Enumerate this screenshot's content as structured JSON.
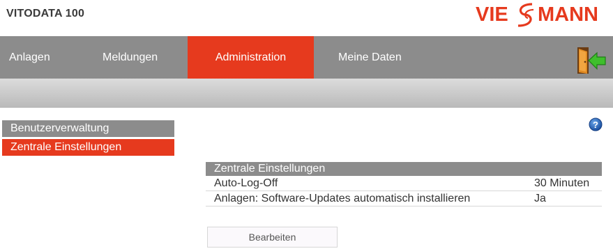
{
  "header": {
    "app_title": "VITODATA 100",
    "logo_text": "VIESSMANN",
    "brand_color": "#e63a1e"
  },
  "nav": {
    "items": [
      {
        "label": "Anlagen",
        "active": false
      },
      {
        "label": "Meldungen",
        "active": false
      },
      {
        "label": "Administration",
        "active": true
      },
      {
        "label": "Meine Daten",
        "active": false
      }
    ],
    "logout_icon": "exit-door-icon"
  },
  "sidebar": {
    "items": [
      {
        "label": "Benutzerverwaltung",
        "active": false
      },
      {
        "label": "Zentrale Einstellungen",
        "active": true
      }
    ]
  },
  "help_icon": "help-icon",
  "panel": {
    "title": "Zentrale Einstellungen",
    "rows": [
      {
        "label": "Auto-Log-Off",
        "value": "30 Minuten"
      },
      {
        "label": "Anlagen: Software-Updates automatisch installieren",
        "value": "Ja"
      }
    ],
    "edit_label": "Bearbeiten"
  },
  "colors": {
    "nav_gray": "#8c8c8c",
    "active_red": "#e63a1e"
  }
}
